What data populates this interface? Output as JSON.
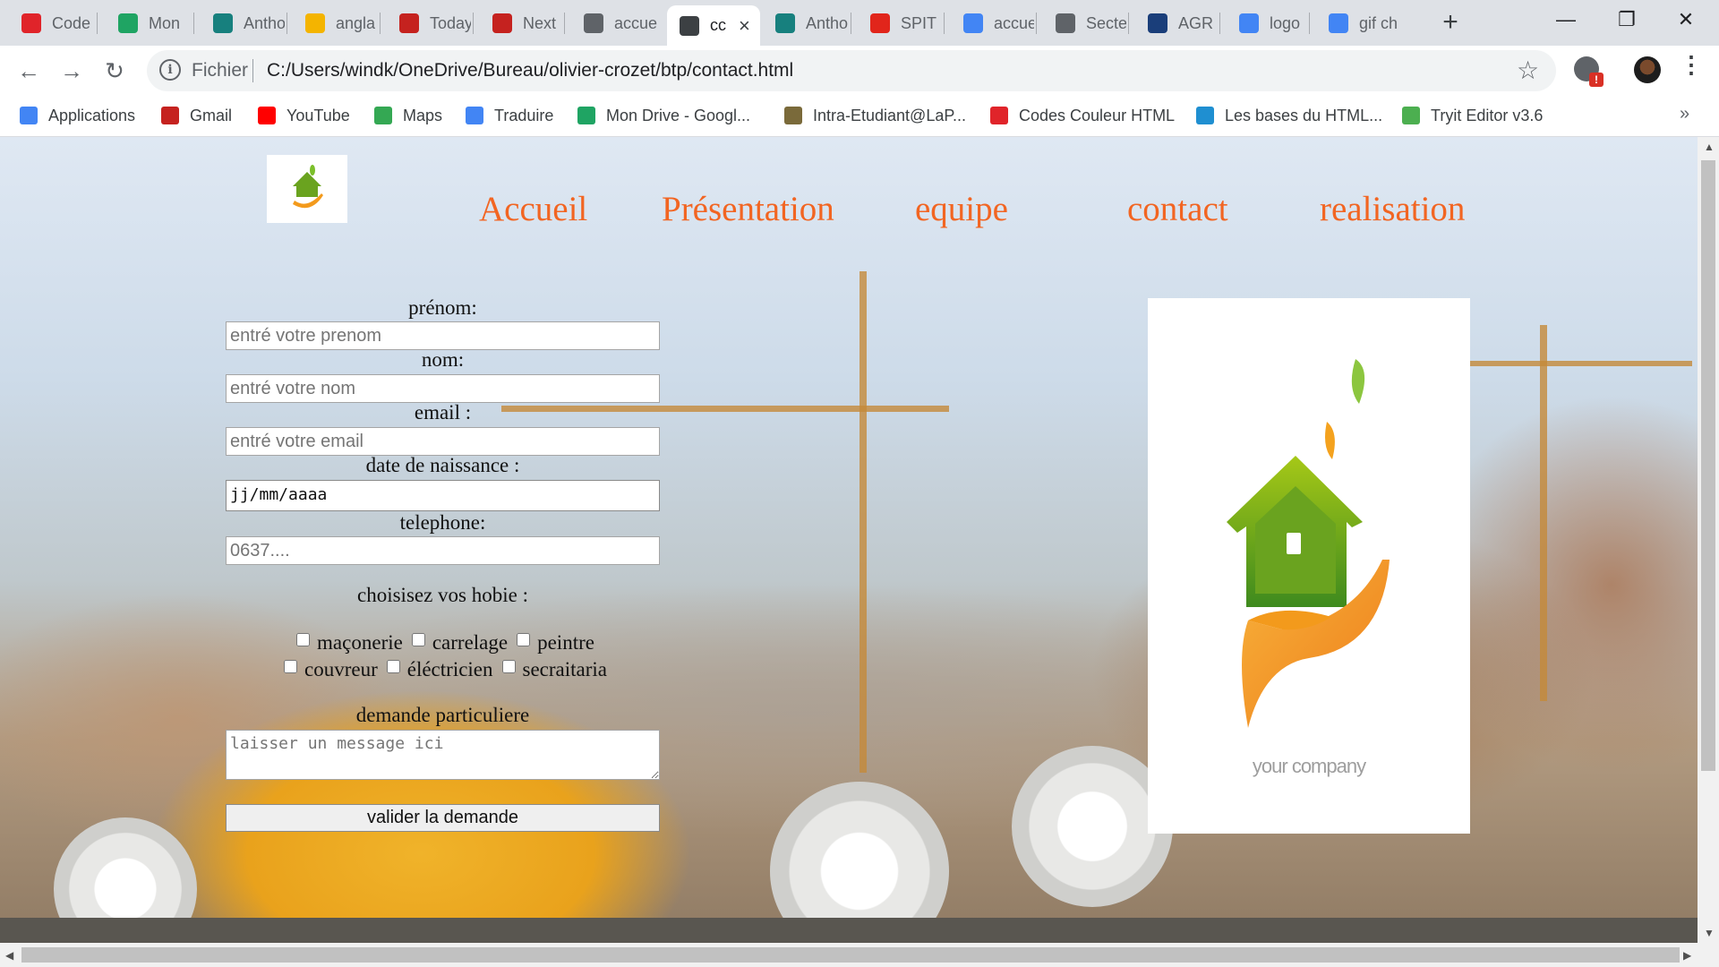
{
  "browser": {
    "tabs": [
      {
        "label": "Code",
        "icon": "opera-icon",
        "color": "#e0242a"
      },
      {
        "label": "Mon",
        "icon": "google-drive-icon",
        "color": "#1fa463"
      },
      {
        "label": "Antho",
        "icon": "anthology-icon",
        "color": "#17807e"
      },
      {
        "label": "angla",
        "icon": "slides-icon",
        "color": "#f4b400"
      },
      {
        "label": "Today",
        "icon": "gmail-icon",
        "color": "#c5221f"
      },
      {
        "label": "Next",
        "icon": "gmail-icon",
        "color": "#c5221f"
      },
      {
        "label": "accue",
        "icon": "globe-icon",
        "color": "#5f6368"
      },
      {
        "label": "cc",
        "icon": "globe-icon",
        "color": "#3c4043",
        "active": true
      },
      {
        "label": "Antho",
        "icon": "anthology-icon",
        "color": "#17807e"
      },
      {
        "label": "SPIT F",
        "icon": "spit-icon",
        "color": "#e1251b"
      },
      {
        "label": "accue",
        "icon": "google-icon",
        "color": "#4285f4"
      },
      {
        "label": "Secte",
        "icon": "document-icon",
        "color": "#5f6368"
      },
      {
        "label": "AGR E",
        "icon": "agr-icon",
        "color": "#1a3e7a"
      },
      {
        "label": "logo",
        "icon": "google-icon",
        "color": "#4285f4"
      },
      {
        "label": "gif ch",
        "icon": "google-icon",
        "color": "#4285f4"
      }
    ],
    "address": {
      "scheme": "Fichier",
      "url": "C:/Users/windk/OneDrive/Bureau/olivier-crozet/btp/contact.html"
    },
    "extension_badge": "!",
    "bookmarks": [
      {
        "label": "Applications",
        "icon": "apps-grid-icon",
        "color": "#4285f4"
      },
      {
        "label": "Gmail",
        "icon": "gmail-icon",
        "color": "#c5221f"
      },
      {
        "label": "YouTube",
        "icon": "youtube-icon",
        "color": "#ff0000"
      },
      {
        "label": "Maps",
        "icon": "maps-icon",
        "color": "#34a853"
      },
      {
        "label": "Traduire",
        "icon": "translate-icon",
        "color": "#4285f4"
      },
      {
        "label": "Mon Drive - Googl...",
        "icon": "google-drive-icon",
        "color": "#1fa463"
      },
      {
        "label": "Intra-Etudiant@LaP...",
        "icon": "intra-icon",
        "color": "#7a6a3a"
      },
      {
        "label": "Codes Couleur HTML",
        "icon": "color-codes-icon",
        "color": "#e0242a"
      },
      {
        "label": "Les bases du HTML...",
        "icon": "html-bases-icon",
        "color": "#1f8fd1"
      },
      {
        "label": "Tryit Editor v3.6",
        "icon": "w3schools-icon",
        "color": "#4caf50"
      }
    ]
  },
  "site": {
    "nav": [
      "Accueil",
      "Présentation",
      "equipe",
      "contact",
      "realisation"
    ],
    "company_text": "your company",
    "form": {
      "prenom_label": "prénom:",
      "prenom_placeholder": "entré votre prenom",
      "nom_label": "nom:",
      "nom_placeholder": "entré votre nom",
      "email_label": "email :",
      "email_placeholder": "entré votre email",
      "birth_label": "date de naissance :",
      "birth_value": "jj/mm/aaaa",
      "phone_label": "telephone:",
      "phone_placeholder": "0637....",
      "hobbies_label": "choisisez vos hobie :",
      "hobbies": [
        "maçonerie",
        "carrelage",
        "peintre",
        "couvreur",
        "éléctricien",
        "secraitaria"
      ],
      "message_label": "demande particuliere",
      "message_placeholder": "laisser un message ici",
      "submit_label": "valider la demande"
    }
  },
  "colors": {
    "nav_link": "#f26522",
    "logo_green": "#6aa31f",
    "logo_orange": "#f39a1c"
  }
}
